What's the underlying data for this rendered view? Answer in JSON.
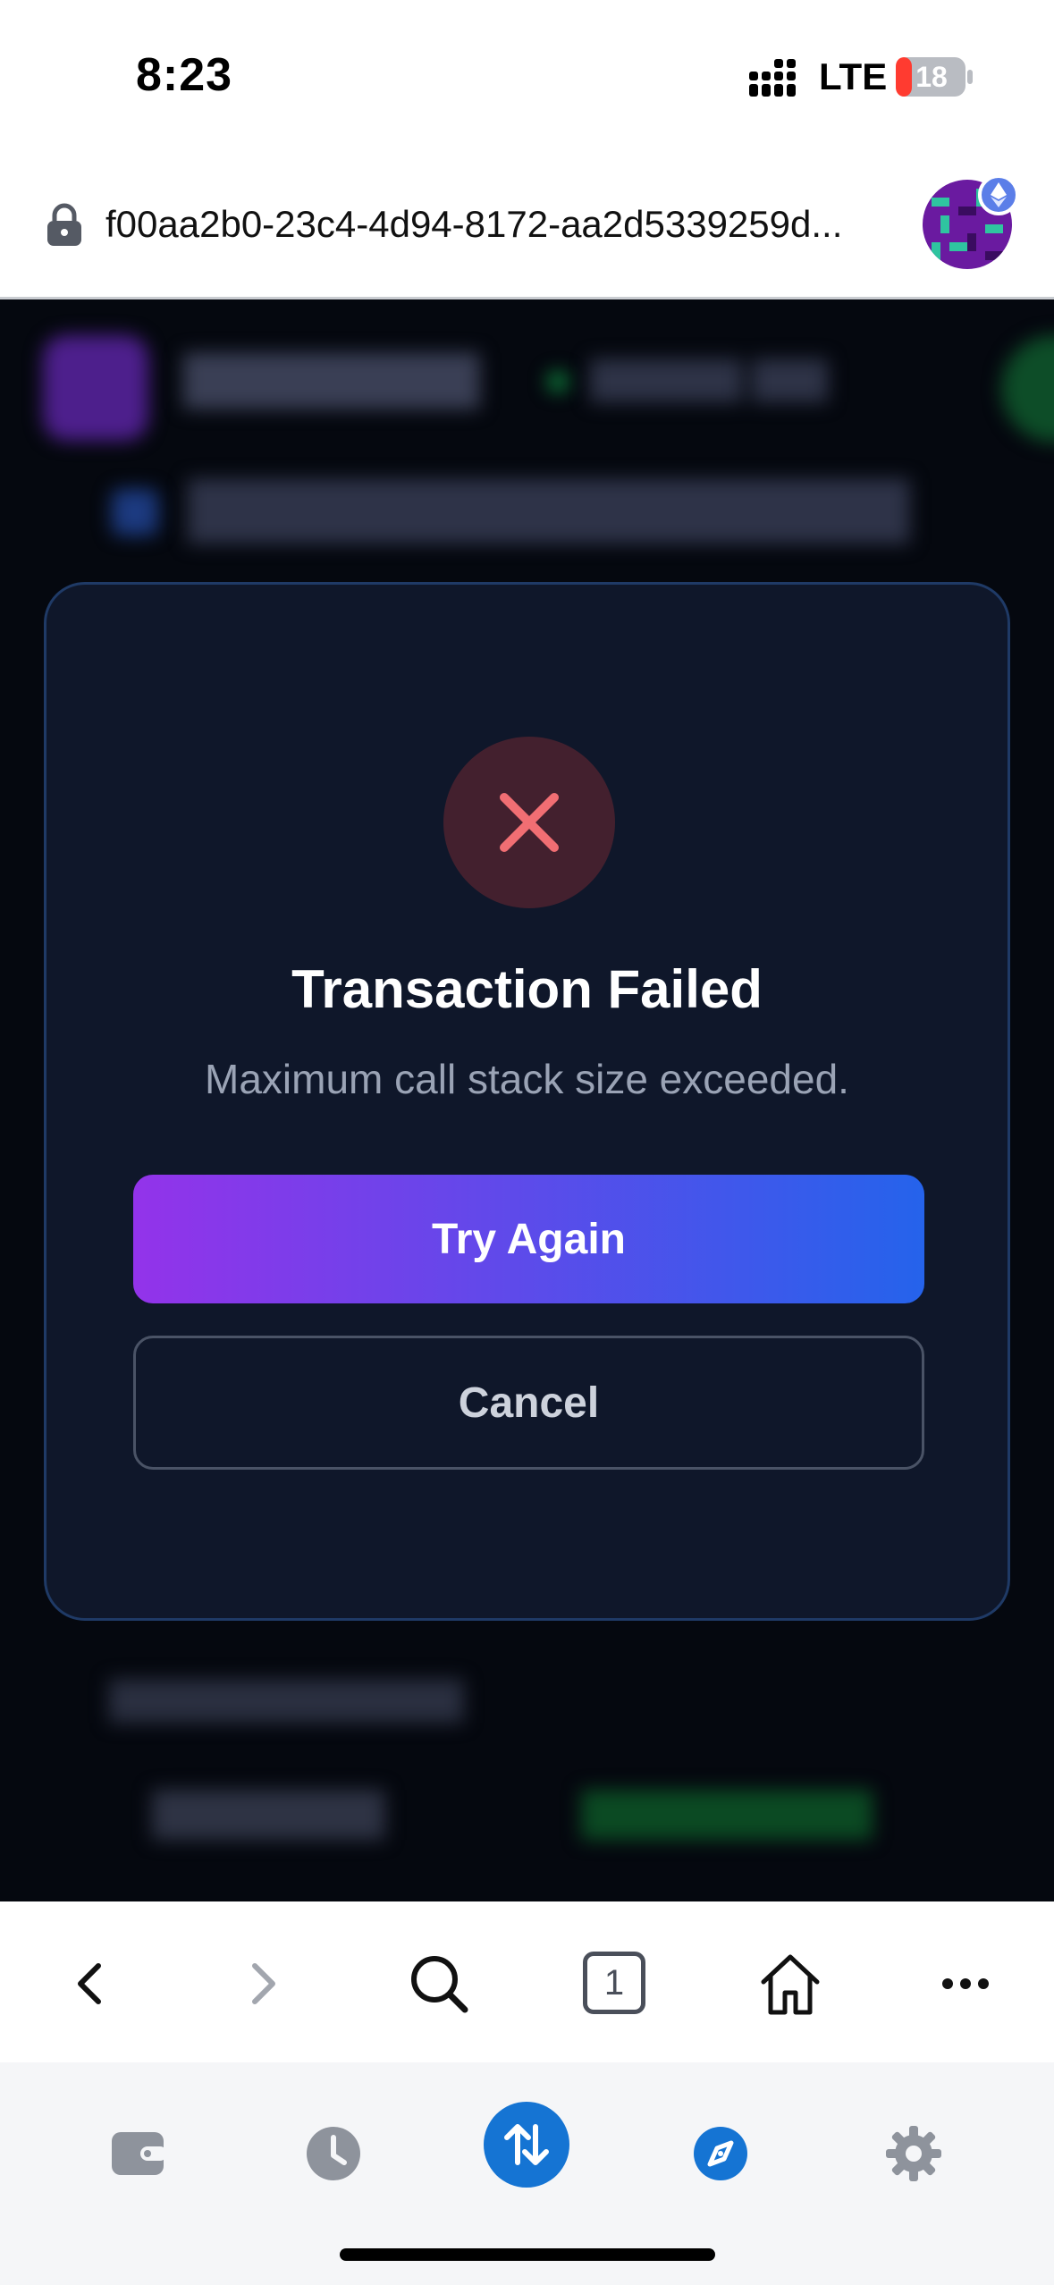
{
  "status_bar": {
    "time": "8:23",
    "network": "LTE",
    "battery": "18",
    "battery_color": "#ff3b30"
  },
  "address_bar": {
    "url": "f00aa2b0-23c4-4d94-8172-aa2d5339259d..."
  },
  "modal": {
    "icon": "close-x-icon",
    "title": "Transaction Failed",
    "message": "Maximum call stack size exceeded.",
    "primary_button": "Try Again",
    "secondary_button": "Cancel",
    "error_color": "#f16e73",
    "gradient_start": "#9333ea",
    "gradient_end": "#2563eb"
  },
  "browser_toolbar": {
    "tab_count": "1",
    "items": [
      "back-icon",
      "forward-icon",
      "search-icon",
      "tabs-icon",
      "home-icon",
      "more-icon"
    ]
  },
  "wallet_nav": {
    "items": [
      "wallet-icon",
      "history-icon",
      "swap-icon",
      "explore-icon",
      "settings-icon"
    ],
    "accent": "#1574d3"
  }
}
